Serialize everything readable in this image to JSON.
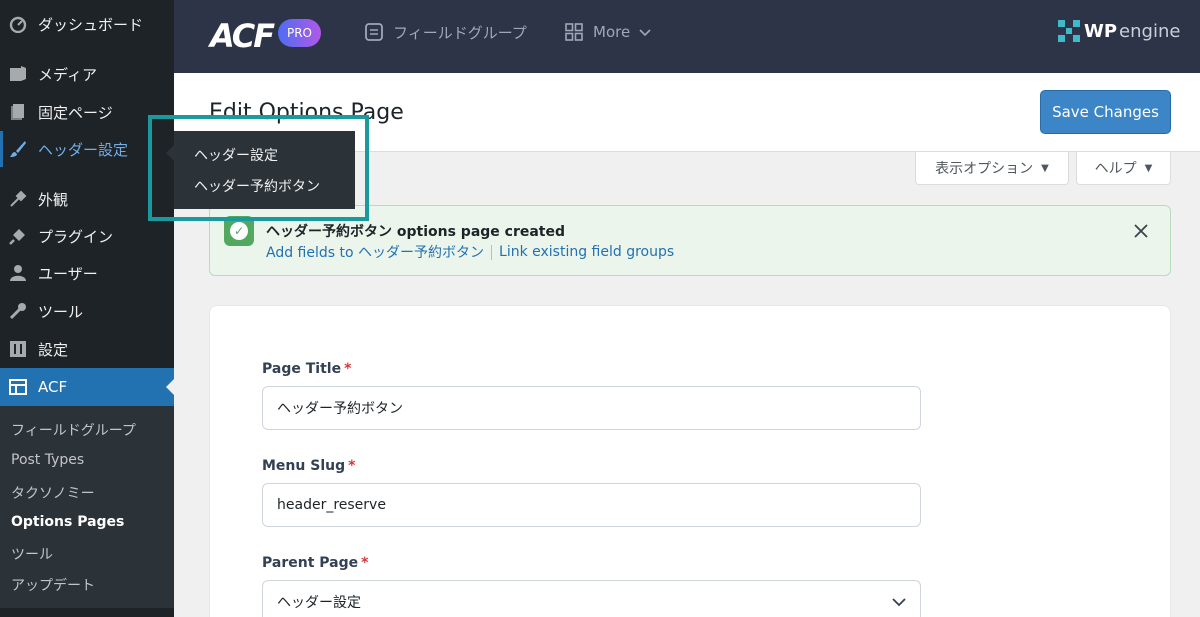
{
  "sidebar": {
    "items": [
      {
        "label": "ダッシュボード",
        "icon": "dashboard-icon"
      },
      {
        "label": "メディア",
        "icon": "media-icon"
      },
      {
        "label": "固定ページ",
        "icon": "pages-icon"
      },
      {
        "label": "ヘッダー設定",
        "icon": "brush-icon"
      },
      {
        "label": "外観",
        "icon": "appearance-icon"
      },
      {
        "label": "プラグイン",
        "icon": "plugins-icon"
      },
      {
        "label": "ユーザー",
        "icon": "users-icon"
      },
      {
        "label": "ツール",
        "icon": "tools-icon"
      },
      {
        "label": "設定",
        "icon": "settings-icon"
      },
      {
        "label": "ACF",
        "icon": "acf-icon"
      }
    ],
    "submenu": [
      "フィールドグループ",
      "Post Types",
      "タクソノミー",
      "Options Pages",
      "ツール",
      "アップデート"
    ]
  },
  "flyout": {
    "items": [
      "ヘッダー設定",
      "ヘッダー予約ボタン"
    ]
  },
  "topbar": {
    "logo": "ACF",
    "badge": "PRO",
    "nav_field_groups": "フィールドグループ",
    "nav_more": "More",
    "brand_wp": "WP",
    "brand_engine": "engine"
  },
  "header": {
    "title": "Edit Options Page",
    "save_label": "Save Changes"
  },
  "screen": {
    "options_label": "表示オプション",
    "help_label": "ヘルプ"
  },
  "notice": {
    "bold": "ヘッダー予約ボタン",
    "rest": " options page created",
    "link_add": "Add fields to ヘッダー予約ボタン",
    "link_existing": "Link existing field groups"
  },
  "form": {
    "page_title_label": "Page Title",
    "page_title_value": "ヘッダー予約ボタン",
    "menu_slug_label": "Menu Slug",
    "menu_slug_value": "header_reserve",
    "parent_label": "Parent Page",
    "parent_value": "ヘッダー設定",
    "required_mark": "*"
  },
  "colors": {
    "accent": "#2271b1",
    "topbar": "#2d3447",
    "highlight_box": "#1a9a9c"
  }
}
